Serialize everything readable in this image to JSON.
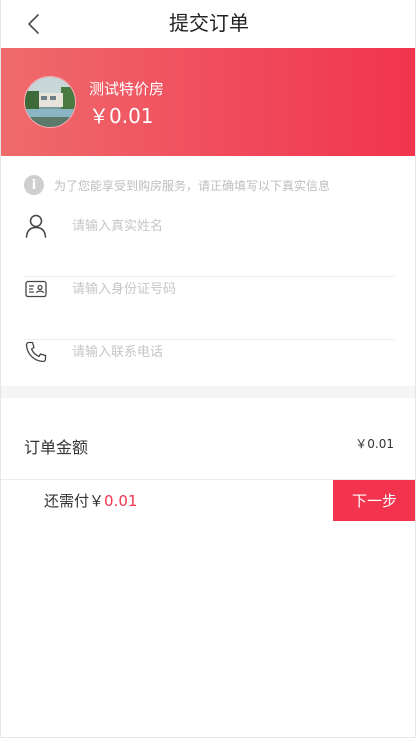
{
  "header": {
    "title": "提交订单",
    "back_icon": "chevron-left-icon"
  },
  "product": {
    "name": "测试特价房",
    "price": "￥0.01"
  },
  "notice": {
    "text": "为了您能享受到购房服务，请正确填写以下真实信息",
    "icon": "info-icon"
  },
  "form": {
    "name_placeholder": "请输入真实姓名",
    "id_placeholder": "请输入身份证号码",
    "phone_placeholder": "请输入联系电话"
  },
  "order": {
    "amount_label": "订单金额",
    "amount_value": "￥0.01"
  },
  "footer": {
    "need_pay_label": "还需付￥",
    "need_pay_amount": "0.01",
    "next_button": "下一步"
  },
  "colors": {
    "accent": "#f2344e",
    "banner_start": "#ef6b6b",
    "placeholder": "#c6c6c6"
  }
}
